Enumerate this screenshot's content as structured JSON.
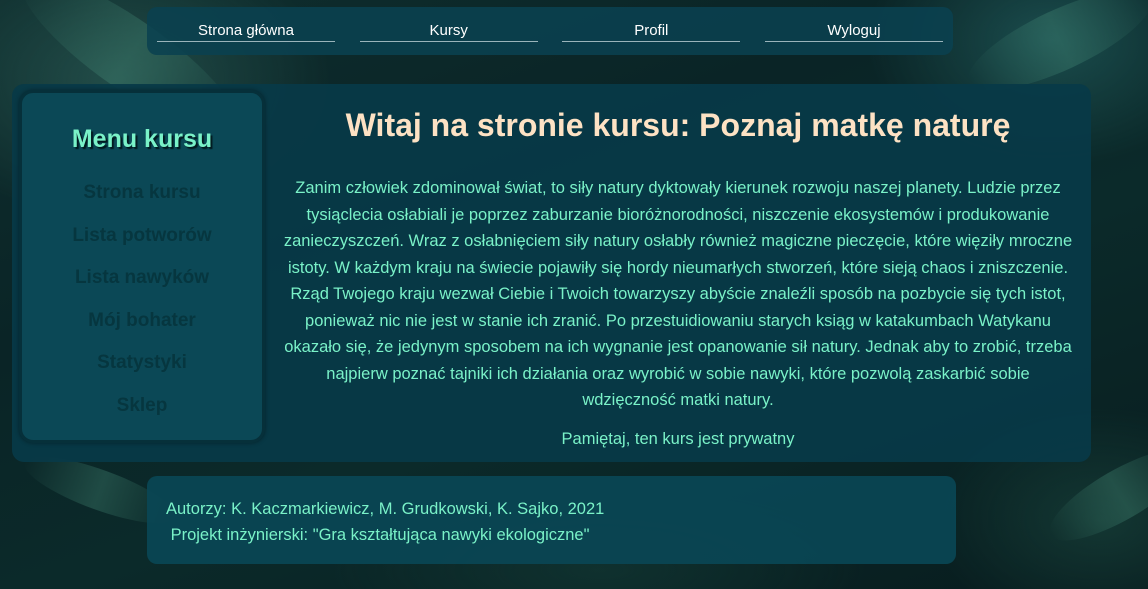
{
  "nav": {
    "items": [
      {
        "label": "Strona główna"
      },
      {
        "label": "Kursy"
      },
      {
        "label": "Profil"
      },
      {
        "label": "Wyloguj"
      }
    ]
  },
  "sidebar": {
    "title": "Menu kursu",
    "items": [
      {
        "label": "Strona kursu"
      },
      {
        "label": "Lista potworów"
      },
      {
        "label": "Lista nawyków"
      },
      {
        "label": "Mój bohater"
      },
      {
        "label": "Statystyki"
      },
      {
        "label": "Sklep"
      }
    ]
  },
  "main": {
    "heading": "Witaj na stronie kursu: Poznaj matkę naturę",
    "intro": "Zanim człowiek zdominował świat, to siły natury dyktowały kierunek rozwoju naszej planety. Ludzie przez tysiąclecia osłabiali je poprzez zaburzanie bioróżnorodności, niszczenie ekosystemów i produkowanie zanieczyszczeń. Wraz z osłabnięciem siły natury osłabły również magiczne pieczęcie, które więziły mroczne istoty. W każdym kraju na świecie pojawiły się hordy nieumarłych stworzeń, które sieją chaos i zniszczenie. Rząd Twojego kraju wezwał Ciebie i Twoich towarzyszy abyście znaleźli sposób na pozbycie się tych istot, ponieważ nic nie jest w stanie ich zranić. Po przestuidiowaniu starych ksiąg w katakumbach Watykanu okazało się, że jedynym sposobem na ich wygnanie jest opanowanie sił natury. Jednak aby to zrobić, trzeba najpierw poznać tajniki ich działania oraz wyrobić w sobie nawyki, które pozwolą zaskarbić sobie wdzięczność matki natury.",
    "note": "Pamiętaj, ten kurs jest prywatny"
  },
  "footer": {
    "authors": "Autorzy: K. Kaczmarkiewicz, M. Grudkowski, K. Sajko, 2021",
    "project": " Projekt inżynierski: \"Gra kształtująca nawyki ekologiczne\""
  },
  "colors": {
    "accent_text": "#7af2c8",
    "heading": "#fde2c4",
    "panel": "#083a48",
    "sidebar_link": "#06363f"
  }
}
